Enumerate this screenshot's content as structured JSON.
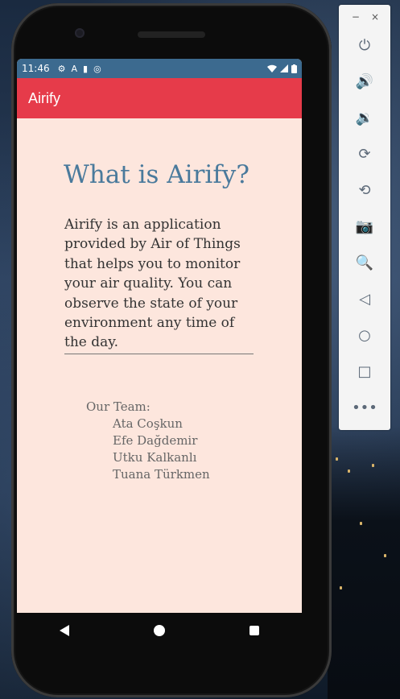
{
  "status_bar": {
    "time": "11:46",
    "notif_icons": [
      "⚙",
      "A",
      "▮",
      "◎"
    ],
    "right_icons": [
      "wifi-icon",
      "signal-icon",
      "battery-icon"
    ]
  },
  "app_bar": {
    "title": "Airify"
  },
  "about": {
    "heading": "What is Airify?",
    "description": "Airify is an application provided by Air of Things that helps you to monitor your air quality. You can observe the state of your environment any time of the day."
  },
  "team": {
    "label": "Our Team:",
    "members": [
      "Ata Coşkun",
      "Efe Dağdemir",
      "Utku Kalkanlı",
      "Tuana Türkmen"
    ]
  },
  "emulator_panel": {
    "minimize": "−",
    "close": "×",
    "tools": [
      "⏻",
      "🔊",
      "🔉",
      "⟳",
      "⟲",
      "📷",
      "🔍",
      "◁",
      "○",
      "□",
      "•••"
    ]
  },
  "colors": {
    "app_bar": "#e63b4a",
    "status_bar": "#3c6a8f",
    "background": "#fde6dd",
    "heading": "#4a7a9c"
  }
}
